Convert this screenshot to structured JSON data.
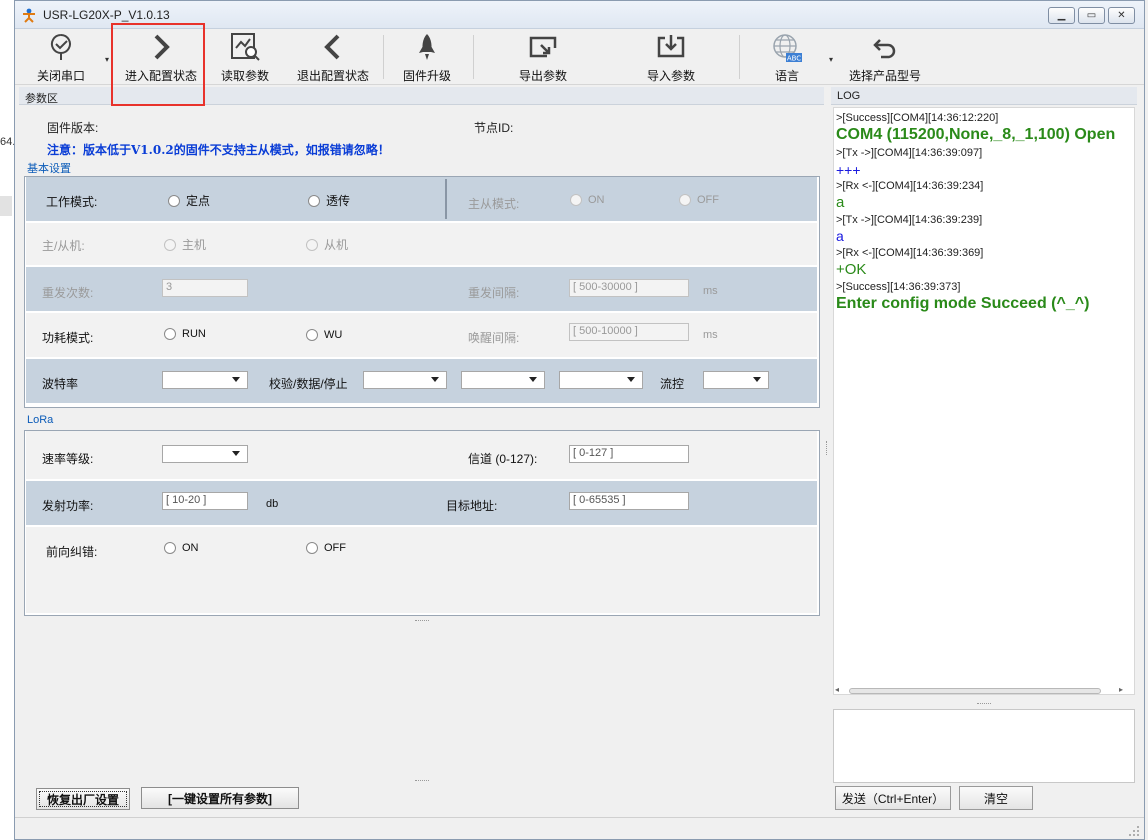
{
  "left_fragment": "64.",
  "window": {
    "title": "USR-LG20X-P_V1.0.13",
    "controls": {
      "minimize": "▁",
      "maximize": "▭",
      "close": "✕"
    }
  },
  "toolbar": {
    "close_port": "关闭串口",
    "enter_config": "进入配置状态",
    "read_params": "读取参数",
    "exit_config": "退出配置状态",
    "firmware_upgrade": "固件升级",
    "export_params": "导出参数",
    "import_params": "导入参数",
    "language": "语言",
    "language_icon_text": "ABC",
    "select_model": "选择产品型号"
  },
  "params": {
    "header": "参数区",
    "firmware_label": "固件版本:",
    "node_id_label": "节点ID:",
    "notice": "注意：版本低于V1.0.2的固件不支持主从模式，如报错请忽略！",
    "basic": {
      "title": "基本设置",
      "work_mode_label": "工作模式:",
      "work_mode_fixed": "定点",
      "work_mode_transparent": "透传",
      "master_slave_mode_label": "主从模式:",
      "ms_on": "ON",
      "ms_off": "OFF",
      "role_label": "主/从机:",
      "role_master": "主机",
      "role_slave": "从机",
      "retry_count_label": "重发次数:",
      "retry_count_value": "3",
      "retry_interval_label": "重发间隔:",
      "retry_interval_value": "[ 500-30000 ]",
      "retry_interval_unit": "ms",
      "power_mode_label": "功耗模式:",
      "power_run": "RUN",
      "power_wu": "WU",
      "wake_interval_label": "唤醒间隔:",
      "wake_interval_value": "[ 500-10000 ]",
      "wake_interval_unit": "ms",
      "baud_label": "波特率",
      "parity_label": "校验/数据/停止",
      "flow_label": "流控"
    },
    "lora": {
      "title": "LoRa",
      "rate_label": "速率等级:",
      "channel_label": "信道 (0-127):",
      "channel_value": "[ 0-127 ]",
      "tx_power_label": "发射功率:",
      "tx_power_value": "[ 10-20 ]",
      "tx_power_unit": "db",
      "target_addr_label": "目标地址:",
      "target_addr_value": "[ 0-65535 ]",
      "fec_label": "前向纠错:",
      "fec_on": "ON",
      "fec_off": "OFF"
    },
    "restore_button": "恢复出厂设置",
    "set_all_button": "[一键设置所有参数]"
  },
  "log": {
    "header": "LOG",
    "lines": [
      ">[Success][COM4][14:36:12:220]",
      "COM4 (115200,None,_8,_1,100) Open",
      ">[Tx ->][COM4][14:36:39:097]",
      "+++",
      ">[Rx <-][COM4][14:36:39:234]",
      "a",
      ">[Tx ->][COM4][14:36:39:239]",
      "a",
      ">[Rx <-][COM4][14:36:39:369]",
      "+OK",
      ">[Success][14:36:39:373]",
      "Enter config mode Succeed   (^_^)"
    ],
    "send_button": "发送（Ctrl+Enter）",
    "clear_button": "清空"
  },
  "colors": {
    "highlight": "#e8322b",
    "row_shade": "#c6d2de",
    "notice": "#0a3dd6",
    "log_green": "#2a8a19",
    "log_blue": "#1a1adf"
  }
}
